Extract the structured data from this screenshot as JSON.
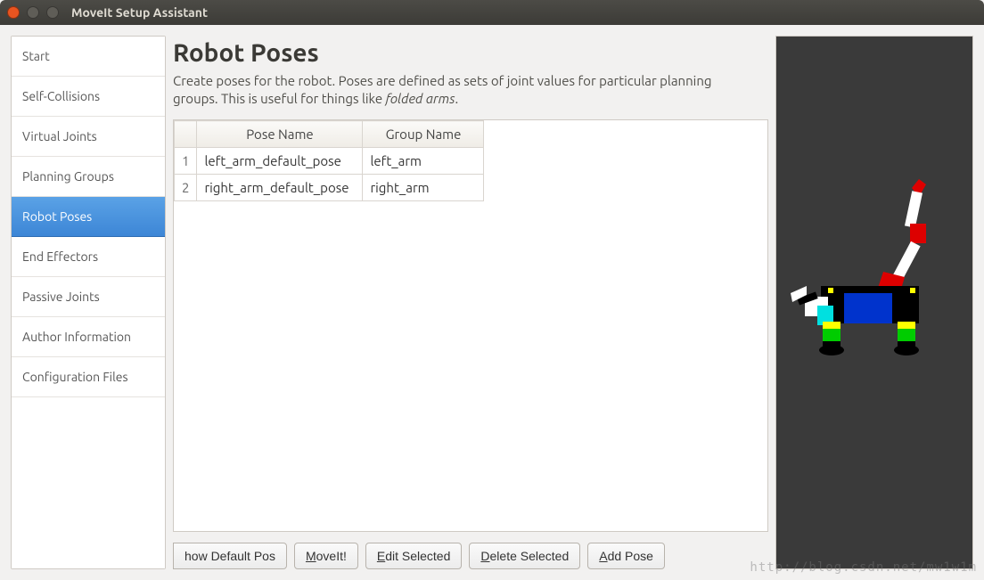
{
  "window": {
    "title": "MoveIt Setup Assistant"
  },
  "sidebar": {
    "items": [
      {
        "label": "Start"
      },
      {
        "label": "Self-Collisions"
      },
      {
        "label": "Virtual Joints"
      },
      {
        "label": "Planning Groups"
      },
      {
        "label": "Robot Poses",
        "active": true
      },
      {
        "label": "End Effectors"
      },
      {
        "label": "Passive Joints"
      },
      {
        "label": "Author Information"
      },
      {
        "label": "Configuration Files"
      }
    ]
  },
  "main": {
    "heading": "Robot Poses",
    "desc_a": "Create poses for the robot. Poses are defined as sets of joint values for particular planning groups. This is useful for things like ",
    "desc_em": "folded arms",
    "desc_b": ".",
    "table": {
      "headers": {
        "pose": "Pose Name",
        "group": "Group Name"
      },
      "rows": [
        {
          "idx": "1",
          "pose": "left_arm_default_pose",
          "group": "left_arm"
        },
        {
          "idx": "2",
          "pose": "right_arm_default_pose",
          "group": "right_arm"
        }
      ]
    },
    "buttons": {
      "show_default": "how Default Pos",
      "moveit_pre": "M",
      "moveit_rest": "oveIt!",
      "edit_pre": "E",
      "edit_rest": "dit Selected",
      "delete_pre": "D",
      "delete_rest": "elete Selected",
      "add_pre": "A",
      "add_rest": "dd Pose"
    }
  },
  "watermark": "http://blog.csdn.net/mw1w1m"
}
